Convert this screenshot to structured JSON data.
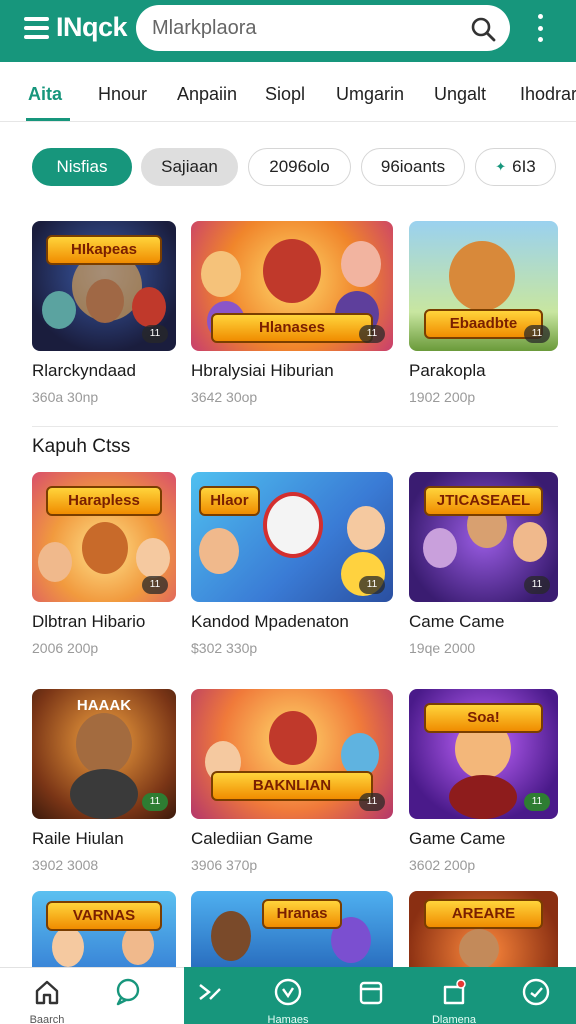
{
  "header": {
    "brand": "INqck",
    "search_placeholder": "Mlarkplaora"
  },
  "tabs": [
    "Aita",
    "Hnour",
    "Anpaiin",
    "Siopl",
    "Umgarin",
    "Ungalt",
    "Ihodrar"
  ],
  "chips": [
    "Nisfias",
    "Sajiaan",
    "2096olo",
    "96ioants",
    "6I3"
  ],
  "section": {
    "title": "Kapuh Ctss"
  },
  "row1": [
    {
      "title": "Rlarckyndaad",
      "meta": "360a 30np",
      "banner": "HIkapeas",
      "badge": "11"
    },
    {
      "title": "Hbralysiai Hiburian",
      "meta": "3642 30op",
      "banner": "Hlanases",
      "badge": "11"
    },
    {
      "title": "Parakopla",
      "meta": "1902 200p",
      "banner": "Ebaadbte",
      "badge": "11"
    }
  ],
  "row2": [
    {
      "title": "Dlbtran Hibario",
      "meta": "2006 200p",
      "banner": "Harapless",
      "badge": "11"
    },
    {
      "title": "Kandod Mpadenaton",
      "meta": "$302 330p",
      "banner": "Hlaor",
      "badge": "11"
    },
    {
      "title": "Came Came",
      "meta": "19qe 2000",
      "banner": "JTICASEAEL",
      "badge": "11"
    }
  ],
  "row3": [
    {
      "title": "Raile Hiulan",
      "meta": "3902 3008",
      "banner": "HAAAK",
      "badge": "11"
    },
    {
      "title": "Calediian Game",
      "meta": "3906 370p",
      "banner": "BAKNLIAN",
      "badge": "11"
    },
    {
      "title": "Game Came",
      "meta": "3602 200p",
      "banner": "Soa!",
      "badge": "11"
    }
  ],
  "row4": [
    {
      "banner": "VARNAS"
    },
    {
      "banner": "Hranas"
    },
    {
      "banner": "AREARE"
    }
  ],
  "bottom_nav": [
    {
      "icon": "home-icon",
      "label": "Baarch"
    },
    {
      "icon": "chat-icon",
      "label": ""
    },
    {
      "icon": "send-icon",
      "label": ""
    },
    {
      "icon": "heart-icon",
      "label": "Hamaes"
    },
    {
      "icon": "library-icon",
      "label": ""
    },
    {
      "icon": "notification-icon",
      "label": "Dlamena"
    },
    {
      "icon": "check-icon",
      "label": ""
    }
  ],
  "colors": {
    "brand": "#17967c",
    "text": "#1b1b1b",
    "meta": "#9a9a9a"
  }
}
